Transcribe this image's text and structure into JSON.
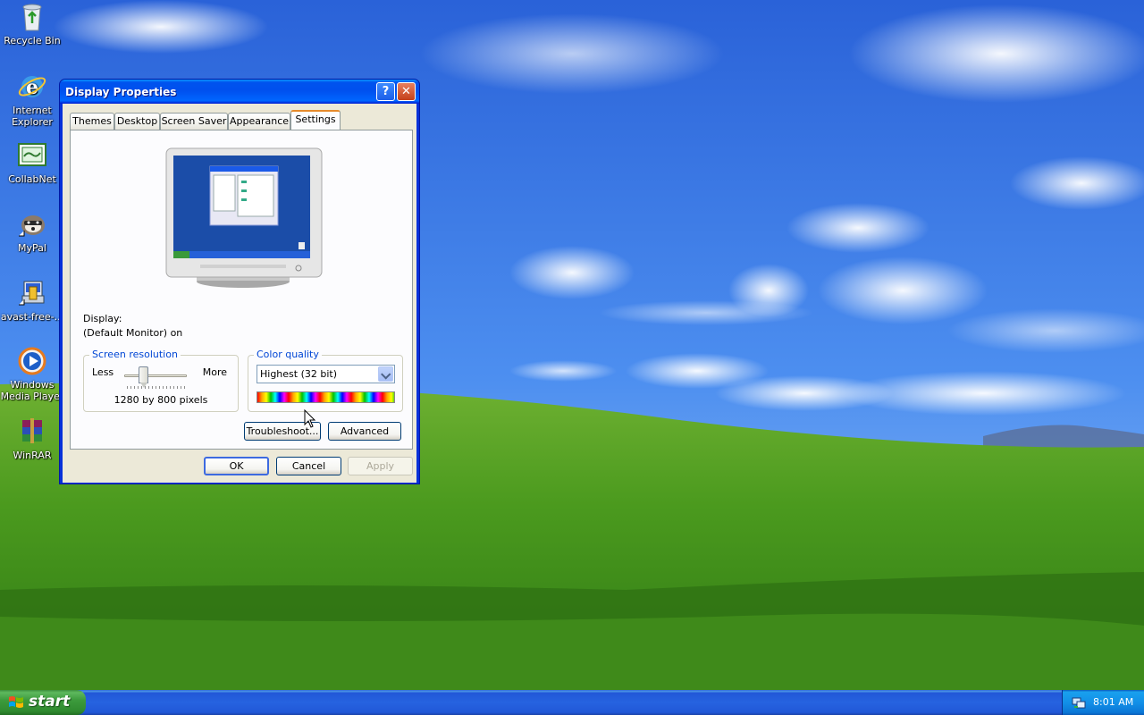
{
  "desktop": {
    "icons": [
      {
        "label": "Recycle Bin",
        "icon": "recycle-bin-icon"
      },
      {
        "label": "Internet Explorer",
        "line1": "Internet",
        "line2": "Explorer",
        "icon": "internet-explorer-icon"
      },
      {
        "label": "CollabNet",
        "icon": "collabnet-icon"
      },
      {
        "label": "MyPal",
        "icon": "mypal-icon"
      },
      {
        "label": "avast-free-...",
        "icon": "avast-installer-icon"
      },
      {
        "label": "Windows Media Player",
        "line1": "Windows",
        "line2": "Media Player",
        "icon": "windows-media-player-icon"
      },
      {
        "label": "WinRAR",
        "icon": "winrar-icon"
      }
    ]
  },
  "dialog": {
    "title": "Display Properties",
    "help_glyph": "?",
    "close_glyph": "✕",
    "tabs": [
      "Themes",
      "Desktop",
      "Screen Saver",
      "Appearance",
      "Settings"
    ],
    "active_tab": "Settings",
    "display_label": "Display:",
    "display_value": "(Default Monitor) on",
    "resolution": {
      "legend": "Screen resolution",
      "less": "Less",
      "more": "More",
      "value": "1280 by 800 pixels",
      "slider_position": 0.3
    },
    "color_quality": {
      "legend": "Color quality",
      "selected": "Highest (32 bit)"
    },
    "buttons": {
      "troubleshoot": "Troubleshoot...",
      "advanced": "Advanced",
      "ok": "OK",
      "cancel": "Cancel",
      "apply": "Apply"
    }
  },
  "taskbar": {
    "start_label": "start",
    "clock": "8:01 AM"
  },
  "colors": {
    "title_bar": "#0054e3",
    "dialog_face": "#ece9d8",
    "start_green": "#3d9b3d",
    "taskbar_blue": "#245edb",
    "tray_blue": "#0f8ee8"
  }
}
